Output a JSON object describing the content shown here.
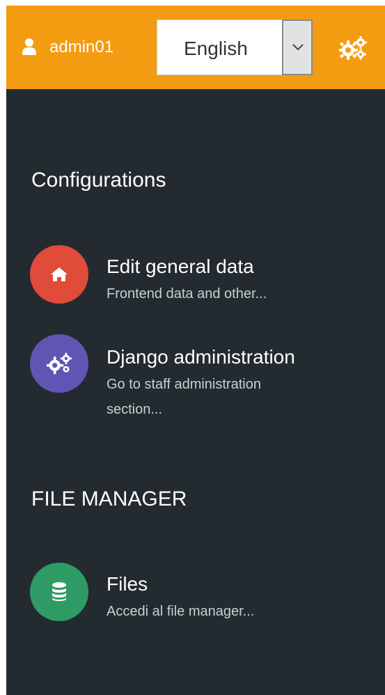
{
  "topbar": {
    "username": "admin01",
    "language": {
      "selected": "English"
    },
    "icons": {
      "user": "user-icon",
      "dropdown": "chevron-down-icon",
      "settings": "gears-icon"
    },
    "color": "#f39c12"
  },
  "sections": [
    {
      "title": "Configurations",
      "items": [
        {
          "title": "Edit general data",
          "description": "Frontend data and other...",
          "icon": "home-icon",
          "color": "#e04b3a"
        },
        {
          "title": "Django administration",
          "description": "Go to staff administration section...",
          "icon": "gears-icon",
          "color": "#5f56b3"
        }
      ]
    },
    {
      "title": "FILE MANAGER",
      "items": [
        {
          "title": "Files",
          "description": "Accedi al file manager...",
          "icon": "database-icon",
          "color": "#2f9b64"
        }
      ]
    }
  ],
  "theme": {
    "sidebar_background": "#232b30",
    "text": "#ffffff",
    "muted_text": "#c9ced1"
  }
}
